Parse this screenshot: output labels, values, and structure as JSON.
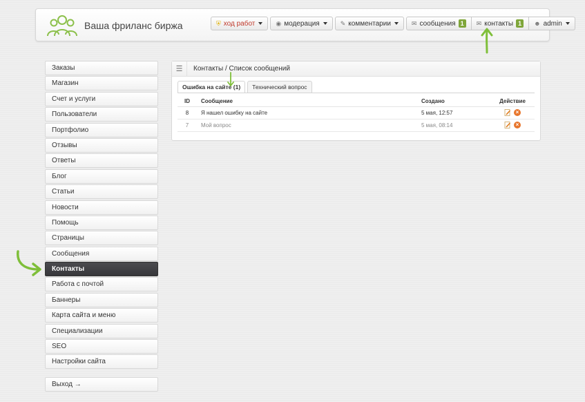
{
  "header": {
    "site_title": "Ваша фриланс биржа",
    "nav": [
      {
        "label": "ход работ",
        "icon": "shield-icon",
        "dropdown": true,
        "warn": true
      },
      {
        "label": "модерация",
        "icon": "eye-icon",
        "dropdown": true
      },
      {
        "label": "комментарии",
        "icon": "pencil-icon",
        "dropdown": true
      },
      {
        "label": "сообщения",
        "icon": "mail-icon",
        "badge": "1"
      },
      {
        "label": "контакты",
        "icon": "mail-icon",
        "badge": "1"
      },
      {
        "label": "admin",
        "icon": "user-icon",
        "dropdown": true
      }
    ]
  },
  "sidebar": {
    "items": [
      "Заказы",
      "Магазин",
      "Счет и услуги",
      "Пользователи",
      "Портфолио",
      "Отзывы",
      "Ответы",
      "Блог",
      "Статьи",
      "Новости",
      "Помощь",
      "Страницы",
      "Сообщения",
      "Контакты",
      "Работа с почтой",
      "Баннеры",
      "Карта сайта и меню",
      "Специализации",
      "SEO",
      "Настройки сайта"
    ],
    "active": "Контакты",
    "logout": "Выход →"
  },
  "panel": {
    "breadcrumb": "Контакты / Список сообщений",
    "tabs": [
      "Ошибка на сайте (1)",
      "Технический вопрос"
    ],
    "columns": {
      "id": "ID",
      "message": "Сообщение",
      "created": "Создано",
      "action": "Действие"
    },
    "rows": [
      {
        "id": "8",
        "message": "Я нашел ошибку на сайте",
        "created": "5 мая, 12:57",
        "muted": false
      },
      {
        "id": "7",
        "message": "Мой вопрос",
        "created": "5 мая, 08:14",
        "muted": true
      }
    ]
  },
  "colors": {
    "badge": "#7fa63a",
    "active_sidebar": "#3f3f42",
    "annotation_arrow": "#7fbf3a",
    "delete_icon": "#e8762c"
  }
}
